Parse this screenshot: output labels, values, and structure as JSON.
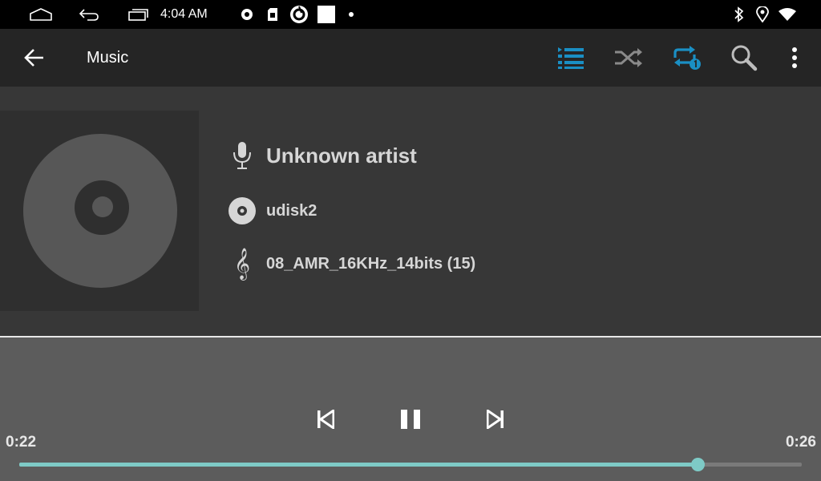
{
  "status_bar": {
    "time": "4:04 AM",
    "icons": [
      "home-icon",
      "back-arrow-icon",
      "recents-icon",
      "record-icon",
      "sd-card-icon",
      "camera-app-icon",
      "notification-square-icon",
      "dot-icon",
      "bluetooth-icon",
      "location-icon",
      "wifi-icon"
    ]
  },
  "app_bar": {
    "title": "Music",
    "actions": [
      "playlist-icon",
      "shuffle-icon",
      "repeat-one-icon",
      "search-icon",
      "overflow-menu-icon"
    ],
    "active_color": "#1a8fc4",
    "inactive_color": "#8a8a8a"
  },
  "track_info": {
    "artist": "Unknown artist",
    "album": "udisk2",
    "title": "08_AMR_16KHz_14bits (15)"
  },
  "player": {
    "elapsed": "0:22",
    "duration": "0:26",
    "progress_fraction": 0.867,
    "state": "playing",
    "accent_color": "#7ecac6"
  }
}
